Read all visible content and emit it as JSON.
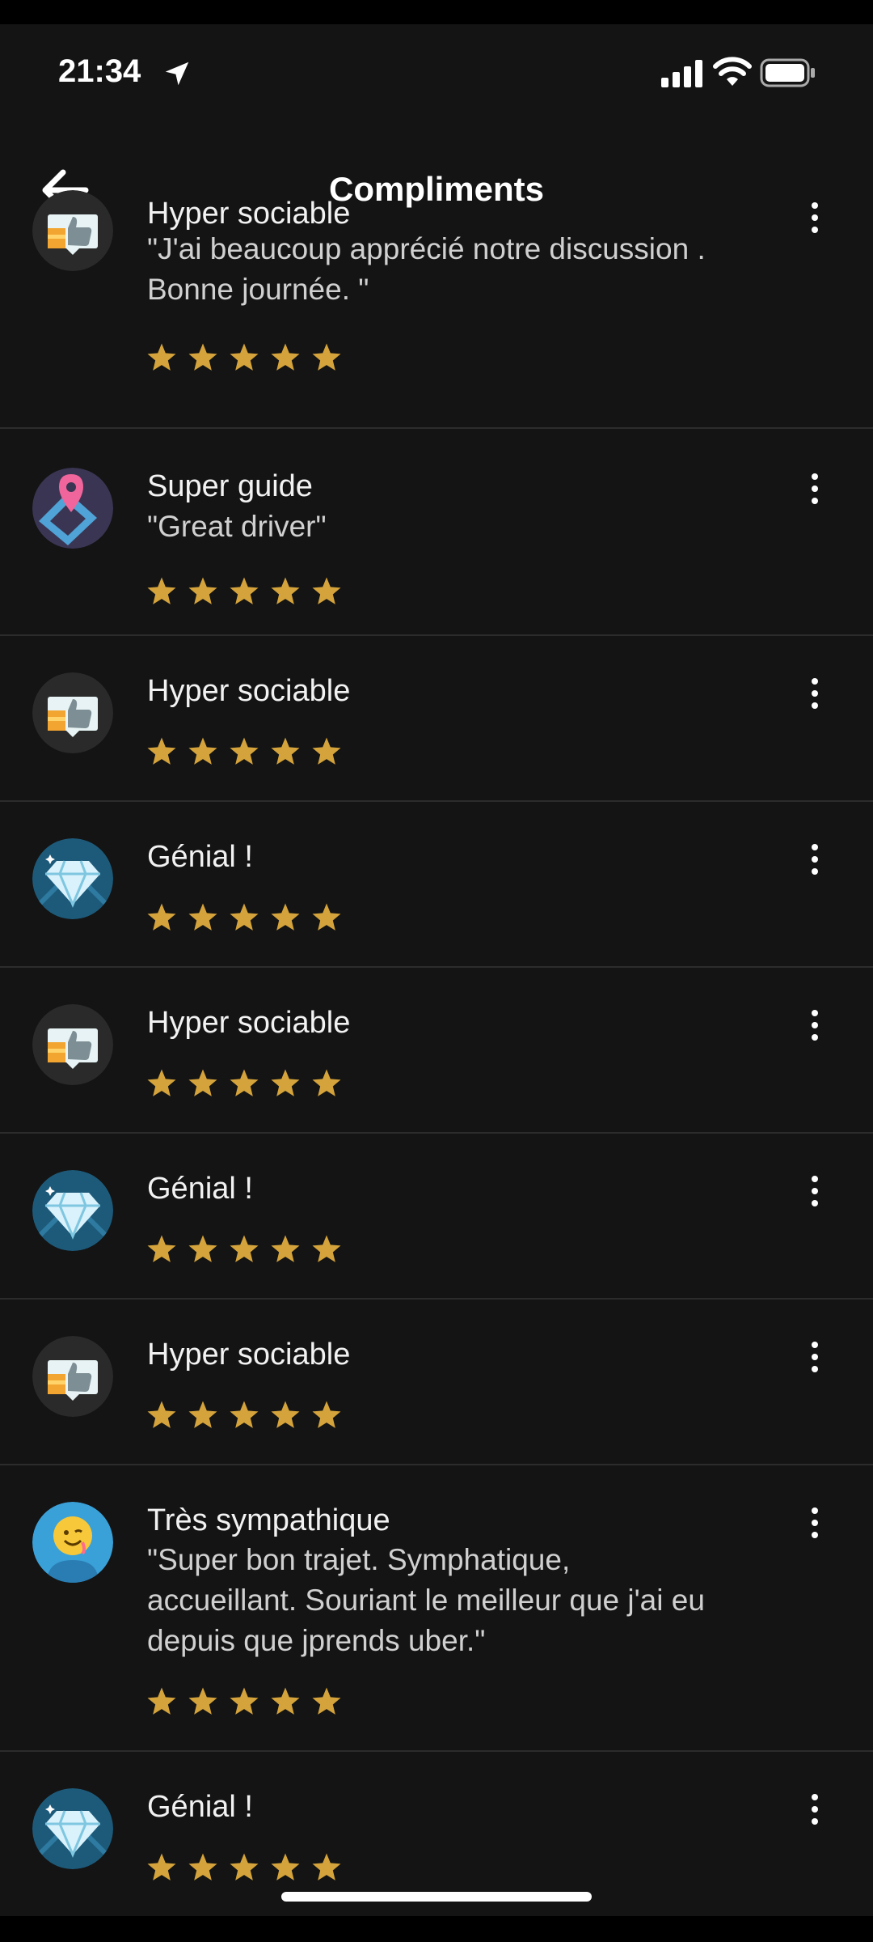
{
  "status_bar": {
    "time": "21:34",
    "icons": [
      "location-arrow-icon",
      "cellular-signal-icon",
      "wifi-icon",
      "battery-icon"
    ]
  },
  "header": {
    "title": "Compliments",
    "back_icon": "arrow-left-icon"
  },
  "colors": {
    "background": "#141414",
    "star": "#D4A33B",
    "divider": "#2c2c2c",
    "text": "#f2f2f2"
  },
  "compliments": [
    {
      "badge": "thumbs-up-badge-icon",
      "title": "Hyper sociable",
      "comment": "\"J'ai beaucoup apprécié notre discussion .\nBonne journée. \"",
      "rating": 5
    },
    {
      "badge": "map-guide-badge-icon",
      "title": "Super guide",
      "comment": "\"Great driver\"",
      "rating": 5
    },
    {
      "badge": "thumbs-up-badge-icon",
      "title": "Hyper sociable",
      "comment": "",
      "rating": 5
    },
    {
      "badge": "diamond-badge-icon",
      "title": "Génial !",
      "comment": "",
      "rating": 5
    },
    {
      "badge": "thumbs-up-badge-icon",
      "title": "Hyper sociable",
      "comment": "",
      "rating": 5
    },
    {
      "badge": "diamond-badge-icon",
      "title": "Génial !",
      "comment": "",
      "rating": 5
    },
    {
      "badge": "thumbs-up-badge-icon",
      "title": "Hyper sociable",
      "comment": "",
      "rating": 5
    },
    {
      "badge": "smiley-badge-icon",
      "title": "Très sympathique",
      "comment": "\"Super bon trajet. Symphatique,\naccueillant. Souriant le meilleur que j'ai eu\ndepuis que jprends uber.\"",
      "rating": 5
    },
    {
      "badge": "diamond-badge-icon",
      "title": "Génial !",
      "comment": "",
      "rating": 5
    }
  ]
}
